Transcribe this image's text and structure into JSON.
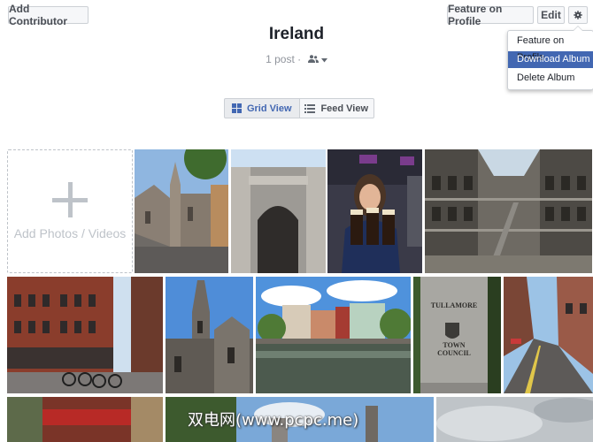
{
  "header": {
    "add_contributor_label": "Add Contributor",
    "feature_on_profile_label": "Feature on Profile",
    "edit_label": "Edit",
    "gear_icon": "gear-icon"
  },
  "album": {
    "title": "Ireland",
    "post_count": "1 post",
    "separator": "·",
    "audience_icon": "friends-icon"
  },
  "settings_menu": {
    "items": [
      "Feature on Profile",
      "Download Album",
      "Delete Album"
    ],
    "highlighted": "Download Album"
  },
  "view_toggle": {
    "grid_label": "Grid View",
    "feed_label": "Feed View",
    "selected": "Grid View"
  },
  "add_tile": {
    "label": "Add Photos / Videos"
  },
  "photos": [
    {
      "subject": "stone church with spire"
    },
    {
      "subject": "stone gate archway"
    },
    {
      "subject": "woman holding pints of stout"
    },
    {
      "subject": "prison hall interior"
    },
    {
      "subject": "red brick street with bikes"
    },
    {
      "subject": "gothic church tower"
    },
    {
      "subject": "river with buildings"
    },
    {
      "subject": "Tullamore Town Council stone"
    },
    {
      "subject": "brick town street"
    },
    {
      "subject": "pub front"
    },
    {
      "subject": "tower and sky"
    },
    {
      "subject": "cloudy sky"
    }
  ],
  "stone_sign": {
    "line1": "TULLAMORE",
    "line2": "TOWN",
    "line3": "COUNCIL"
  },
  "watermark": "双电网(www.pcpc.me)",
  "colors": {
    "accent": "#4267b2",
    "button_bg": "#f6f7f9",
    "border": "#ccd0d5",
    "muted_text": "#90949c"
  }
}
